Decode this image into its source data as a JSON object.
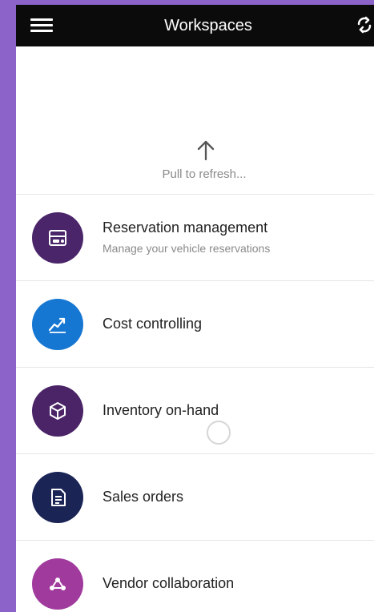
{
  "header": {
    "title": "Workspaces",
    "menu_icon": "hamburger-menu-icon",
    "refresh_icon": "sync-icon"
  },
  "pull_to_refresh": {
    "text": "Pull to refresh...",
    "icon": "up-arrow-icon"
  },
  "workspaces": [
    {
      "title": "Reservation management",
      "subtitle": "Manage your vehicle reservations",
      "icon": "vehicle-reservation-icon",
      "color": "#4a2569"
    },
    {
      "title": "Cost controlling",
      "subtitle": "",
      "icon": "cost-chart-icon",
      "color": "#1677d2"
    },
    {
      "title": "Inventory on-hand",
      "subtitle": "",
      "icon": "inventory-boxes-icon",
      "color": "#4a2466"
    },
    {
      "title": "Sales orders",
      "subtitle": "",
      "icon": "sales-order-document-icon",
      "color": "#1a2556"
    },
    {
      "title": "Vendor collaboration",
      "subtitle": "",
      "icon": "vendor-network-icon",
      "color": "#a03b9d"
    }
  ],
  "colors": {
    "page_background": "#8b63c9",
    "header_background": "#0b0b0b"
  }
}
